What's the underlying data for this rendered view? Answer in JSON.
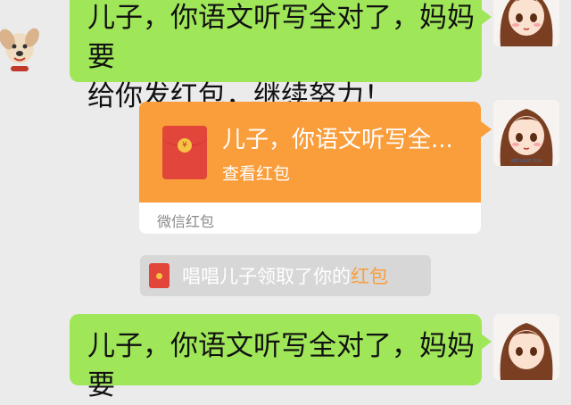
{
  "chat": {
    "messages": [
      {
        "type": "text",
        "lines": [
          "儿子，你语文听写全对了，妈妈要",
          "给你发红包，继续努力！"
        ]
      },
      {
        "type": "red_packet",
        "title": "儿子，你语文听写全...",
        "action": "查看红包",
        "footer": "微信红包"
      },
      {
        "type": "system",
        "prefix": "唱唱儿子领取了你的",
        "highlight": "红包"
      },
      {
        "type": "text",
        "lines": [
          "儿子，你语文听写全对了，妈妈要"
        ]
      }
    ]
  },
  "avatars": {
    "girl_caption": "WE LOVE YOU"
  },
  "icons": {
    "red_packet": "red-packet-icon",
    "avatar_girl": "girl-avatar-icon",
    "avatar_dog": "dog-avatar-icon"
  },
  "colors": {
    "background": "#ebebeb",
    "bubble_green": "#9fe659",
    "red_packet_orange": "#fa9d3b",
    "red_packet_red": "#e2453a",
    "system_pill": "#d7d7d7"
  }
}
